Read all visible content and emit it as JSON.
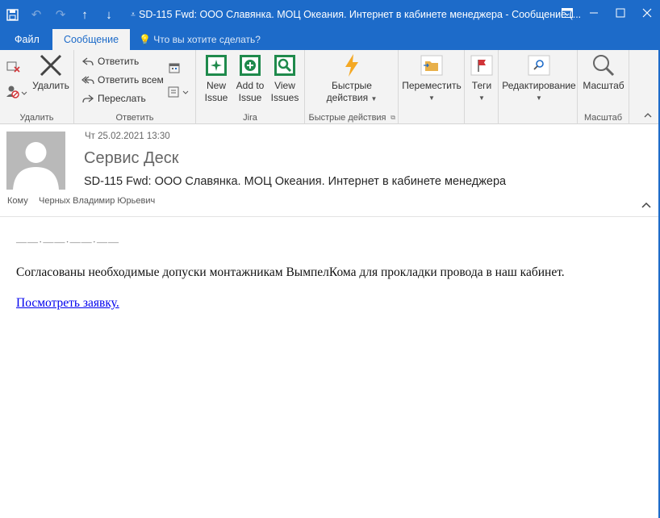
{
  "window": {
    "title": "SD-115 Fwd: ООО Славянка. МОЦ Океания. Интернет в кабинете менеджера  -  Сообщение (..."
  },
  "qat": {
    "icons": [
      "save-icon",
      "undo-icon",
      "redo-icon",
      "arrow-up-icon",
      "arrow-down-icon",
      "customize-icon"
    ]
  },
  "tabs": {
    "file": "Файл",
    "message": "Сообщение",
    "tell_me": "Что вы хотите сделать?"
  },
  "ribbon": {
    "delete_group": {
      "label": "Удалить",
      "delete_button": "Удалить"
    },
    "respond_group": {
      "label": "Ответить",
      "reply": "Ответить",
      "reply_all": "Ответить всем",
      "forward": "Переслать"
    },
    "jira_group": {
      "label": "Jira",
      "new_issue": [
        "New",
        "Issue"
      ],
      "add_to_issue": [
        "Add to",
        "Issue"
      ],
      "view_issues": [
        "View",
        "Issues"
      ]
    },
    "quick_group": {
      "label": "Быстрые действия",
      "button": [
        "Быстрые",
        "действия"
      ]
    },
    "move": "Переместить",
    "tags": "Теги",
    "editing": "Редактирование",
    "zoom_group": {
      "label": "Масштаб",
      "button": "Масштаб"
    }
  },
  "message": {
    "date": "Чт 25.02.2021 13:30",
    "sender": "Сервис Деск",
    "subject": "SD-115 Fwd: ООО Славянка. МОЦ Океания. Интернет в кабинете менеджера",
    "to_label": "Кому",
    "to_name": "Черных Владимир Юрьевич"
  },
  "body": {
    "separator": "——·——·——·——",
    "paragraph": "Согласованы необходимые допуски монтажникам ВымпелКома для прокладки провода в наш кабинет.",
    "link": "Посмотреть заявку."
  },
  "colors": {
    "accent": "#1d6bc9",
    "ribbon_bg": "#f3f3f3",
    "jira_green": "#1f8a4c",
    "link": "#0000ee"
  }
}
